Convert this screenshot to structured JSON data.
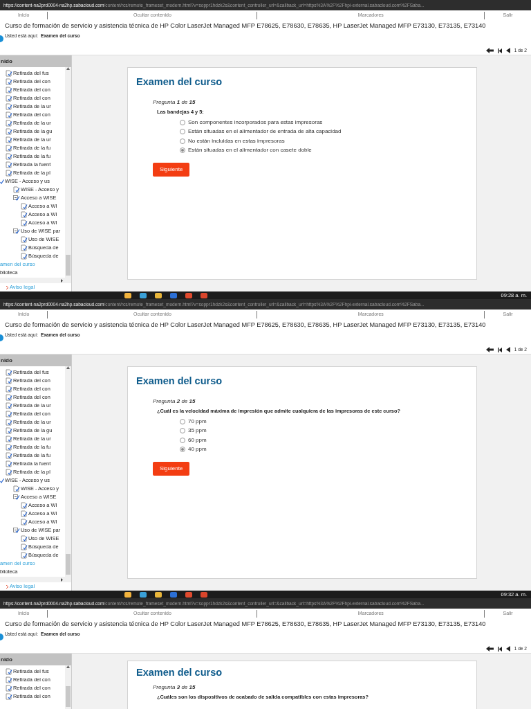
{
  "screens": [
    {
      "url": {
        "host": "https://content-na2prd0004-na2hp.sabacloud.com",
        "path": "/content/rcs/remote_frameset_modern.html?v=soppr1hdzk2s&content_controller_url=&callback_url=https%3A%2F%2Fhpi-external.sabacloud.com%2FSaba..."
      },
      "nav": [
        "Inicio",
        "Ocultar contenido",
        "Marcadores",
        "Salir"
      ],
      "course_title": "Curso de formación de servicio y asistencia técnica de HP Color LaserJet Managed MFP E78625, E78630, E78635, HP LaserJet Managed MFP E73130, E73135, E73140",
      "breadcrumb": {
        "label": "Usted está aquí:",
        "current": "Examen del curso"
      },
      "pager": "1 de 2",
      "sidebar": {
        "header": "nido",
        "footer_link": "Aviso legal",
        "items": [
          {
            "label": "Retirada del fus",
            "kind": "page",
            "selected": false
          },
          {
            "label": "Retirada del con",
            "kind": "page",
            "selected": false
          },
          {
            "label": "Retirada del con",
            "kind": "page",
            "selected": false
          },
          {
            "label": "Retirada del con",
            "kind": "page",
            "selected": false
          },
          {
            "label": "Retirada de la ur",
            "kind": "page",
            "selected": false
          },
          {
            "label": "Retirada del con",
            "kind": "page",
            "selected": false
          },
          {
            "label": "Retirada de la ur",
            "kind": "page",
            "selected": false
          },
          {
            "label": "Retirada de la gu",
            "kind": "page",
            "selected": false
          },
          {
            "label": "Retirada de la ur",
            "kind": "page",
            "selected": false
          },
          {
            "label": "Retirada de la fu",
            "kind": "page",
            "selected": false
          },
          {
            "label": "Retirada de la fu",
            "kind": "page",
            "selected": false
          },
          {
            "label": "Retirada la fuent",
            "kind": "page",
            "selected": false
          },
          {
            "label": "Retirada de la pl",
            "kind": "page",
            "selected": false
          },
          {
            "label": "WISE - Acceso y us",
            "kind": "module",
            "selected": false,
            "children": [
              {
                "label": "WISE - Acceso y",
                "kind": "page",
                "selected": false
              },
              {
                "label": "Acceso a WISE",
                "kind": "folder",
                "selected": false,
                "children": [
                  {
                    "label": "Acceso a WI",
                    "kind": "page",
                    "selected": false
                  },
                  {
                    "label": "Acceso a WI",
                    "kind": "page",
                    "selected": false
                  },
                  {
                    "label": "Acceso a WI",
                    "kind": "page",
                    "selected": false
                  }
                ]
              },
              {
                "label": "Uso de WISE par",
                "kind": "folder",
                "selected": false,
                "children": [
                  {
                    "label": "Uso de WISE",
                    "kind": "page",
                    "selected": false
                  },
                  {
                    "label": "Búsqueda de",
                    "kind": "page",
                    "selected": false
                  },
                  {
                    "label": "Búsqueda de",
                    "kind": "page",
                    "selected": false
                  }
                ]
              }
            ]
          },
          {
            "label": "amen del curso",
            "kind": "plain",
            "selected": true
          },
          {
            "label": "blioteca",
            "kind": "plain",
            "selected": false
          }
        ]
      },
      "exam": {
        "title": "Examen del curso",
        "counter": "Pregunta **1** de **15**",
        "question": "Las bandejas 4 y 5:",
        "options": [
          {
            "label": "Son componentes incorporados para estas impresoras",
            "selected": false
          },
          {
            "label": "Están situadas en el alimentador de entrada de alta capacidad",
            "selected": false
          },
          {
            "label": "No están incluidas en estas impresoras",
            "selected": false
          },
          {
            "label": "Están situadas en el alimentador con casete doble",
            "selected": true
          }
        ],
        "button": "Siguiente"
      },
      "taskbar": {
        "time": "09:28 a. m."
      }
    },
    {
      "url": {
        "host": "https://content-na2prd0004-na2hp.sabacloud.com",
        "path": "/content/rcs/remote_frameset_modern.html?v=soppr1hdzk2s&content_controller_url=&callback_url=https%3A%2F%2Fhpi-external.sabacloud.com%2FSaba..."
      },
      "nav": [
        "Inicio",
        "Ocultar contenido",
        "Marcadores",
        "Salir"
      ],
      "course_title": "Curso de formación de servicio y asistencia técnica de HP Color LaserJet Managed MFP E78625, E78630, E78635, HP LaserJet Managed MFP E73130, E73135, E73140",
      "breadcrumb": {
        "label": "Usted está aquí:",
        "current": "Examen del curso"
      },
      "pager": "1 de 2",
      "sidebar": {
        "header": "nido",
        "footer_link": "Aviso legal",
        "items": [
          {
            "label": "Retirada del fus",
            "kind": "page",
            "selected": false
          },
          {
            "label": "Retirada del con",
            "kind": "page",
            "selected": false
          },
          {
            "label": "Retirada del con",
            "kind": "page",
            "selected": false
          },
          {
            "label": "Retirada del con",
            "kind": "page",
            "selected": false
          },
          {
            "label": "Retirada de la ur",
            "kind": "page",
            "selected": false
          },
          {
            "label": "Retirada del con",
            "kind": "page",
            "selected": false
          },
          {
            "label": "Retirada de la ur",
            "kind": "page",
            "selected": false
          },
          {
            "label": "Retirada de la gu",
            "kind": "page",
            "selected": false
          },
          {
            "label": "Retirada de la ur",
            "kind": "page",
            "selected": false
          },
          {
            "label": "Retirada de la fu",
            "kind": "page",
            "selected": false
          },
          {
            "label": "Retirada de la fu",
            "kind": "page",
            "selected": false
          },
          {
            "label": "Retirada la fuent",
            "kind": "page",
            "selected": false
          },
          {
            "label": "Retirada de la pl",
            "kind": "page",
            "selected": false
          },
          {
            "label": "WISE - Acceso y us",
            "kind": "module",
            "selected": false,
            "children": [
              {
                "label": "WISE - Acceso y",
                "kind": "page",
                "selected": false
              },
              {
                "label": "Acceso a WISE",
                "kind": "folder",
                "selected": false,
                "children": [
                  {
                    "label": "Acceso a WI",
                    "kind": "page",
                    "selected": false
                  },
                  {
                    "label": "Acceso a WI",
                    "kind": "page",
                    "selected": false
                  },
                  {
                    "label": "Acceso a WI",
                    "kind": "page",
                    "selected": false
                  }
                ]
              },
              {
                "label": "Uso de WISE par",
                "kind": "folder",
                "selected": false,
                "children": [
                  {
                    "label": "Uso de WISE",
                    "kind": "page",
                    "selected": false
                  },
                  {
                    "label": "Búsqueda de",
                    "kind": "page",
                    "selected": false
                  },
                  {
                    "label": "Búsqueda de",
                    "kind": "page",
                    "selected": false
                  }
                ]
              }
            ]
          },
          {
            "label": "amen del curso",
            "kind": "plain",
            "selected": true
          },
          {
            "label": "blioteca",
            "kind": "plain",
            "selected": false
          }
        ]
      },
      "exam": {
        "title": "Examen del curso",
        "counter": "Pregunta **2** de **15**",
        "question": "¿Cuál es la velocidad máxima de impresión que admite cualquiera de las impresoras de este curso?",
        "options": [
          {
            "label": "70 ppm",
            "selected": false
          },
          {
            "label": "35 ppm",
            "selected": false
          },
          {
            "label": "60 ppm",
            "selected": false
          },
          {
            "label": "40 ppm",
            "selected": true
          }
        ],
        "button": "Siguiente"
      },
      "taskbar": {
        "time": "09:32 a. m."
      }
    },
    {
      "url": {
        "host": "https://content-na2prd0004-na2hp.sabacloud.com",
        "path": "/content/rcs/remote_frameset_modern.html?v=soppr1hdzk2s&content_controller_url=&callback_url=https%3A%2F%2Fhpi-external.sabacloud.com%2FSaba..."
      },
      "nav": [
        "Inicio",
        "Ocultar contenido",
        "Marcadores",
        "Salir"
      ],
      "course_title": "Curso de formación de servicio y asistencia técnica de HP Color LaserJet Managed MFP E78625, E78630, E78635, HP LaserJet Managed MFP E73130, E73135, E73140",
      "breadcrumb": {
        "label": "Usted está aquí:",
        "current": "Examen del curso"
      },
      "pager": "1 de 2",
      "sidebar": {
        "header": "nido",
        "items": [
          {
            "label": "Retirada del fus",
            "kind": "page",
            "selected": false
          },
          {
            "label": "Retirada del con",
            "kind": "page",
            "selected": false
          },
          {
            "label": "Retirada del con",
            "kind": "page",
            "selected": false
          },
          {
            "label": "Retirada del con",
            "kind": "page",
            "selected": false
          }
        ]
      },
      "exam": {
        "title": "Examen del curso",
        "counter": "Pregunta **3** de **15**",
        "question": "¿Cuáles son los dispositivos de acabado de salida compatibles con estas impresoras?"
      }
    }
  ]
}
